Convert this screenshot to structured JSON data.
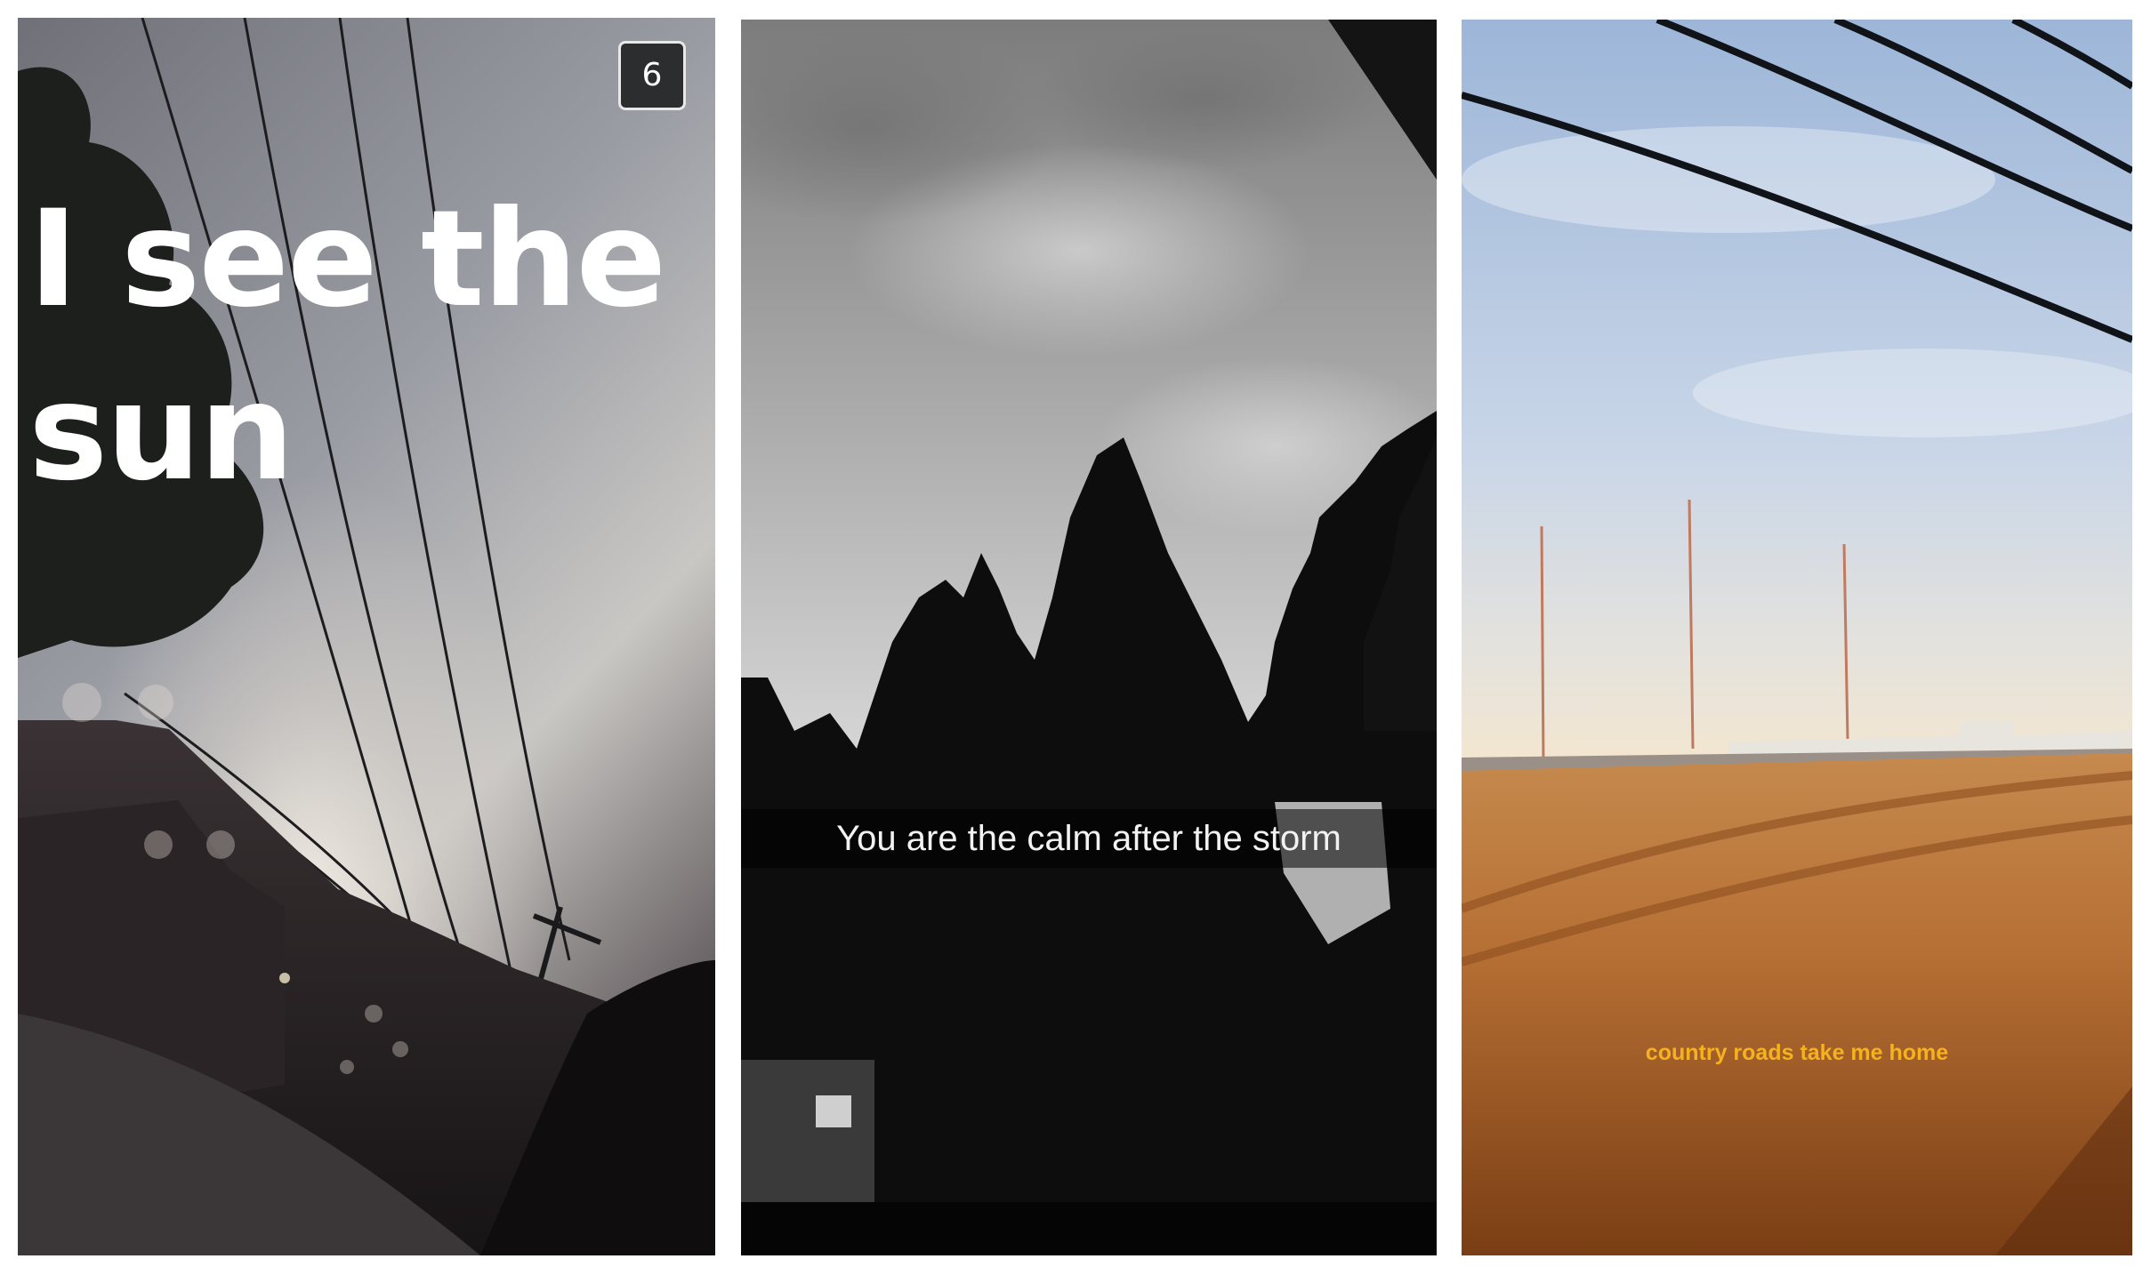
{
  "snaps": [
    {
      "timer_seconds": "6",
      "caption": "I see the\nsun"
    },
    {
      "caption": "You are the calm after the storm"
    },
    {
      "caption": "country roads take me home",
      "caption_color": "#f6b21e"
    }
  ]
}
